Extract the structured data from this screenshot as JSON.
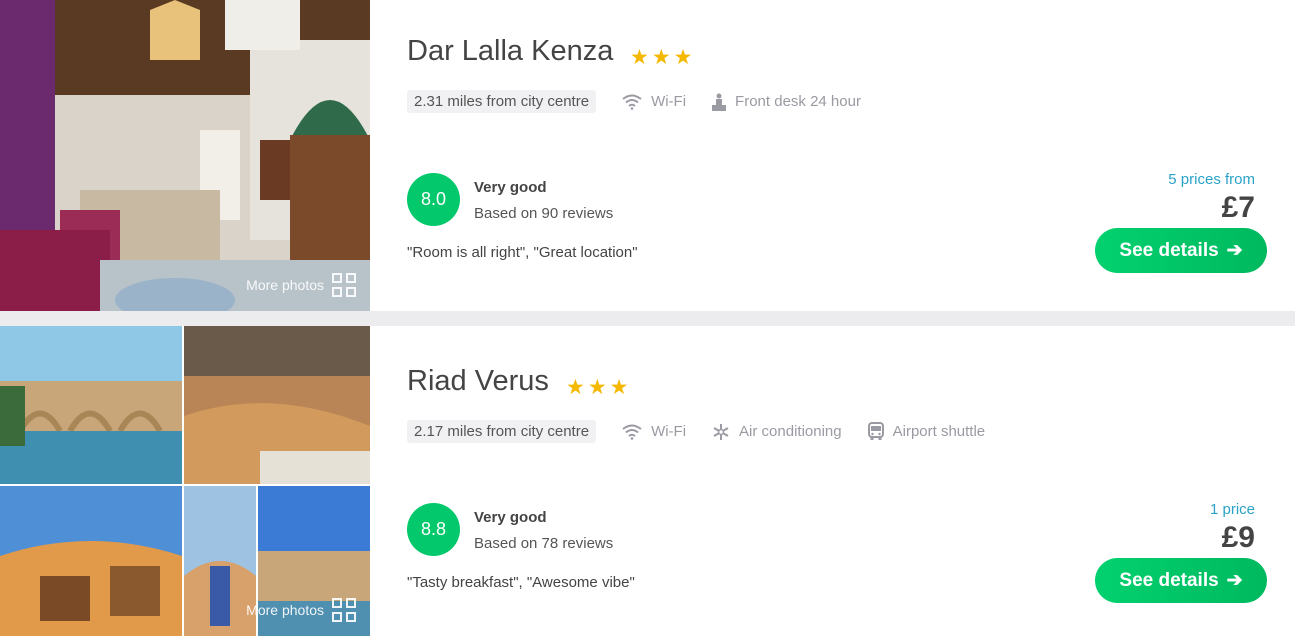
{
  "common": {
    "more_photos": "More photos",
    "see_details": "See details",
    "arrow": "➔",
    "star": "★"
  },
  "hotels": [
    {
      "name": "Dar Lalla Kenza",
      "stars": 3,
      "distance": "2.31 miles from city centre",
      "amenities": [
        {
          "icon": "wifi-icon",
          "label": "Wi-Fi"
        },
        {
          "icon": "front-desk-icon",
          "label": "Front desk 24 hour"
        }
      ],
      "score": "8.0",
      "rating_label": "Very good",
      "rating_count": "Based on 90 reviews",
      "quote": "\"Room is all right\", \"Great location\"",
      "prices_from": "5 prices from",
      "price": "£7"
    },
    {
      "name": "Riad Verus",
      "stars": 3,
      "distance": "2.17 miles from city centre",
      "amenities": [
        {
          "icon": "wifi-icon",
          "label": "Wi-Fi"
        },
        {
          "icon": "snowflake-icon",
          "label": "Air conditioning"
        },
        {
          "icon": "bus-icon",
          "label": "Airport shuttle"
        }
      ],
      "score": "8.8",
      "rating_label": "Very good",
      "rating_count": "Based on 78 reviews",
      "quote": "\"Tasty breakfast\", \"Awesome vibe\"",
      "prices_from": "1 price",
      "price": "£9"
    }
  ],
  "colors": {
    "score": "#04c86c",
    "button": "#02c467",
    "star": "#f5b800",
    "link": "#2aa2c8"
  }
}
